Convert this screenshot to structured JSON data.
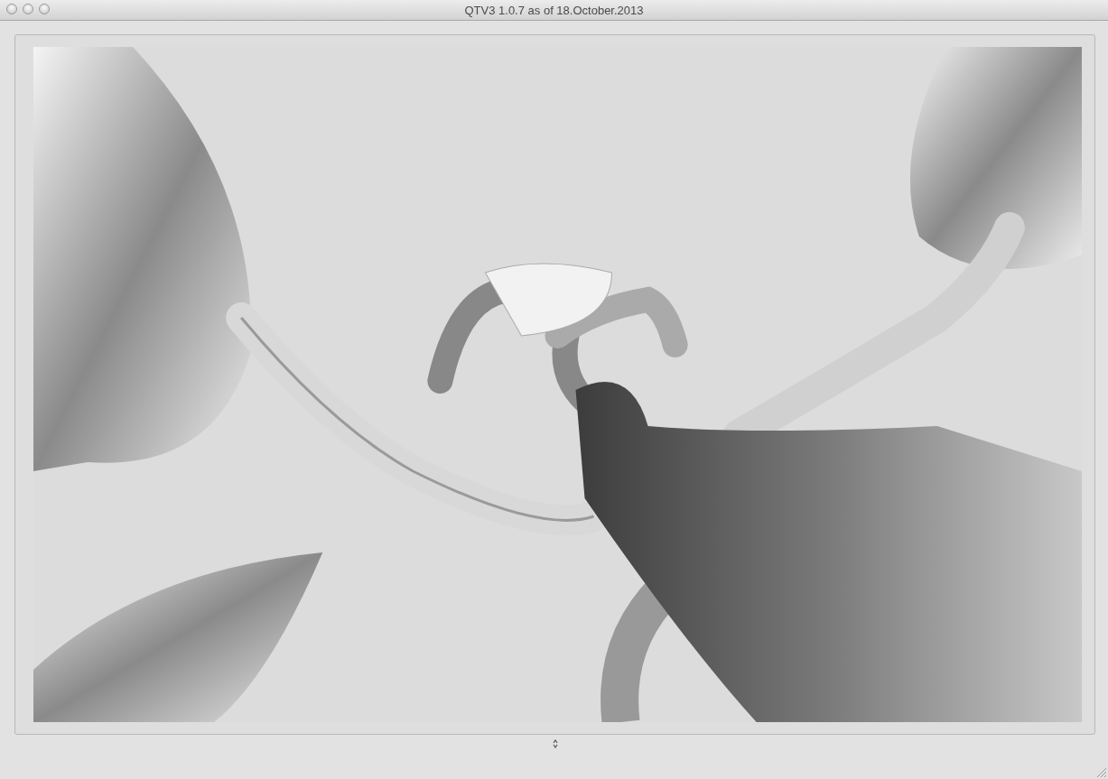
{
  "window": {
    "title": "QTV3 1.0.7 as of 18.October.2013"
  }
}
